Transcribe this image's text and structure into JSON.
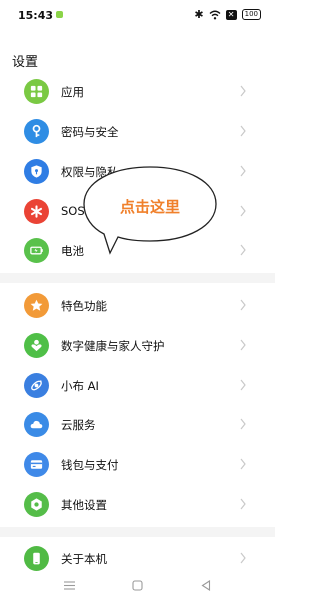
{
  "status": {
    "time": "15:43",
    "battery": "100"
  },
  "page": {
    "title": "设置"
  },
  "items": [
    {
      "label": "应用",
      "icon": "grid-icon",
      "color": "#7ac943"
    },
    {
      "label": "密码与安全",
      "icon": "key-icon",
      "color": "#2f8de4"
    },
    {
      "label": "权限与隐私",
      "icon": "shield-icon",
      "color": "#2f7de4"
    },
    {
      "label": "SOS",
      "icon": "asterisk-icon",
      "color": "#ea4335"
    },
    {
      "label": "电池",
      "icon": "battery-icon",
      "color": "#59c14b"
    },
    {
      "label": "特色功能",
      "icon": "star-icon",
      "color": "#f29a38"
    },
    {
      "label": "数字健康与家人守护",
      "icon": "heart-person-icon",
      "color": "#4fbf47"
    },
    {
      "label": "小布 AI",
      "icon": "ai-icon",
      "color": "#3a7fe0"
    },
    {
      "label": "云服务",
      "icon": "cloud-icon",
      "color": "#3a8be6"
    },
    {
      "label": "钱包与支付",
      "icon": "wallet-icon",
      "color": "#3f89e8"
    },
    {
      "label": "其他设置",
      "icon": "gear-icon",
      "color": "#55bd49"
    },
    {
      "label": "关于本机",
      "icon": "phone-icon",
      "color": "#50ba44"
    }
  ],
  "callout": {
    "text": "点击这里"
  }
}
